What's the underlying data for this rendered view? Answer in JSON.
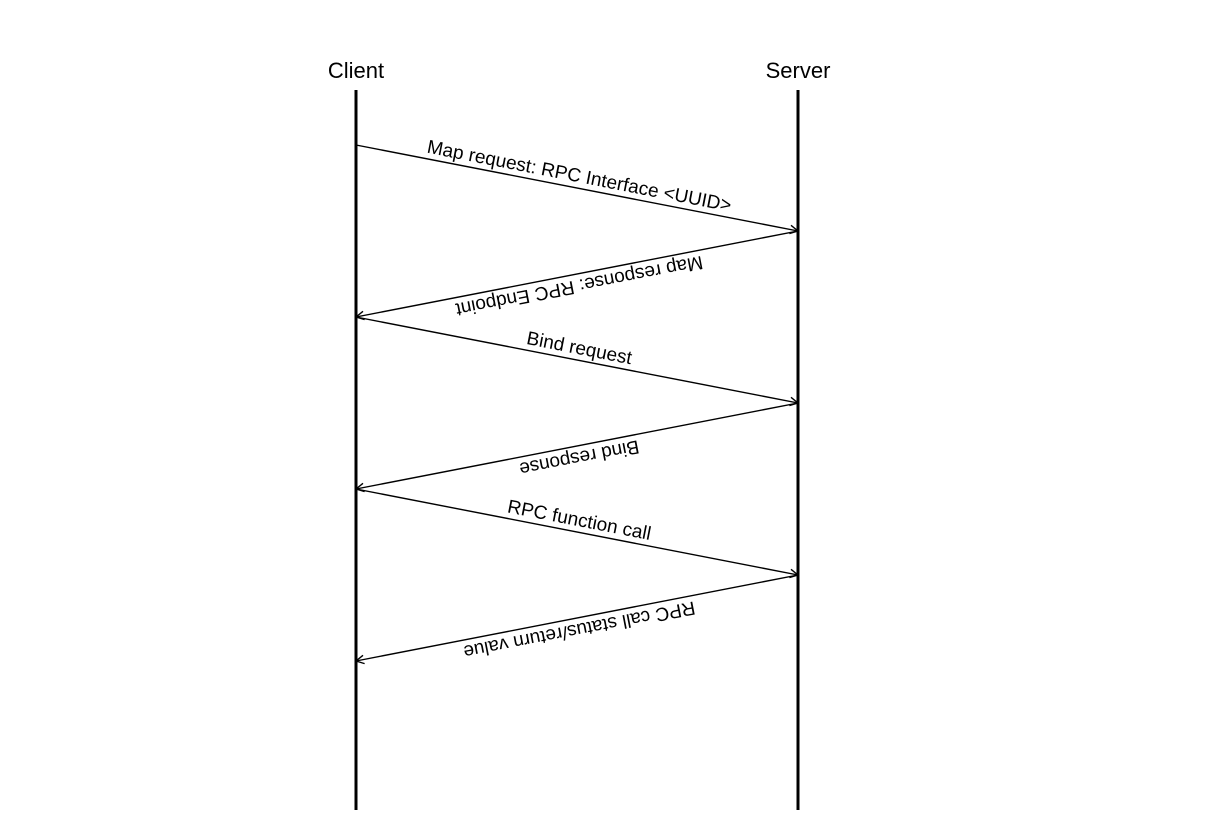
{
  "actors": {
    "client": "Client",
    "server": "Server"
  },
  "messages": [
    {
      "text": "Map request: RPC Interface <UUID>",
      "direction": "right"
    },
    {
      "text": "Map response: RPC Endpoint",
      "direction": "left"
    },
    {
      "text": "Bind request",
      "direction": "right"
    },
    {
      "text": "Bind response",
      "direction": "left"
    },
    {
      "text": "RPC function call",
      "direction": "right"
    },
    {
      "text": "RPC call status/return value",
      "direction": "left"
    }
  ],
  "layout": {
    "clientX": 356,
    "serverX": 798,
    "lifelineTop": 90,
    "lifelineBottom": 810,
    "msgStartY": 145,
    "msgVerticalGap": 86,
    "msgSlant": 86,
    "arrowSize": 9
  }
}
